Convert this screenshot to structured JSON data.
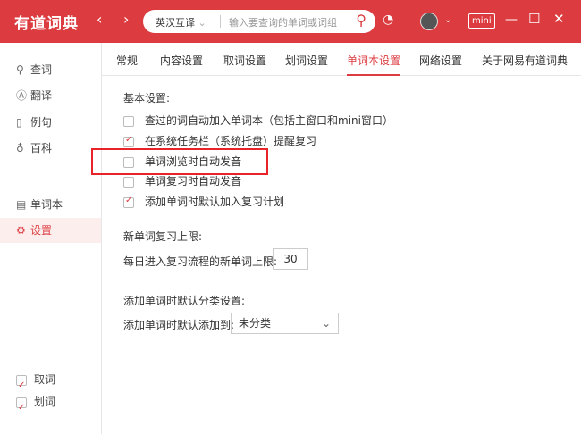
{
  "titlebar": {
    "logo": "有道词典",
    "back": "‹",
    "forward": "›",
    "search_mode": "英汉互译",
    "search_mode_chevron": "⌄",
    "search_placeholder": "输入要查询的单词或词组",
    "mini": "mini"
  },
  "sidebar": {
    "items": [
      {
        "label": "查词",
        "icon": "search-icon"
      },
      {
        "label": "翻译",
        "icon": "translate-icon"
      },
      {
        "label": "例句",
        "icon": "example-icon"
      },
      {
        "label": "百科",
        "icon": "bulb-icon"
      },
      {
        "label": "单词本",
        "icon": "notebook-icon"
      },
      {
        "label": "设置",
        "icon": "gear-icon"
      }
    ],
    "bottom": [
      {
        "label": "取词",
        "checked": true
      },
      {
        "label": "划词",
        "checked": true
      }
    ]
  },
  "tabs": [
    "常规",
    "内容设置",
    "取词设置",
    "划词设置",
    "单词本设置",
    "网络设置",
    "关于网易有道词典"
  ],
  "active_tab": "单词本设置",
  "basic": {
    "title": "基本设置:",
    "options": [
      {
        "label": "查过的词自动加入单词本（包括主窗口和mini窗口）",
        "checked": false
      },
      {
        "label": "在系统任务栏（系统托盘）提醒复习",
        "checked": true
      },
      {
        "label": "单词浏览时自动发音",
        "checked": false
      },
      {
        "label": "单词复习时自动发音",
        "checked": false
      },
      {
        "label": "添加单词时默认加入复习计划",
        "checked": true
      }
    ]
  },
  "review": {
    "title": "新单词复习上限:",
    "label": "每日进入复习流程的新单词上限:",
    "value": "30"
  },
  "category": {
    "title": "添加单词时默认分类设置:",
    "label": "添加单词时默认添加到:",
    "value": "未分类"
  },
  "colors": {
    "brand": "#dc3c40",
    "highlight": "#e8232a"
  }
}
